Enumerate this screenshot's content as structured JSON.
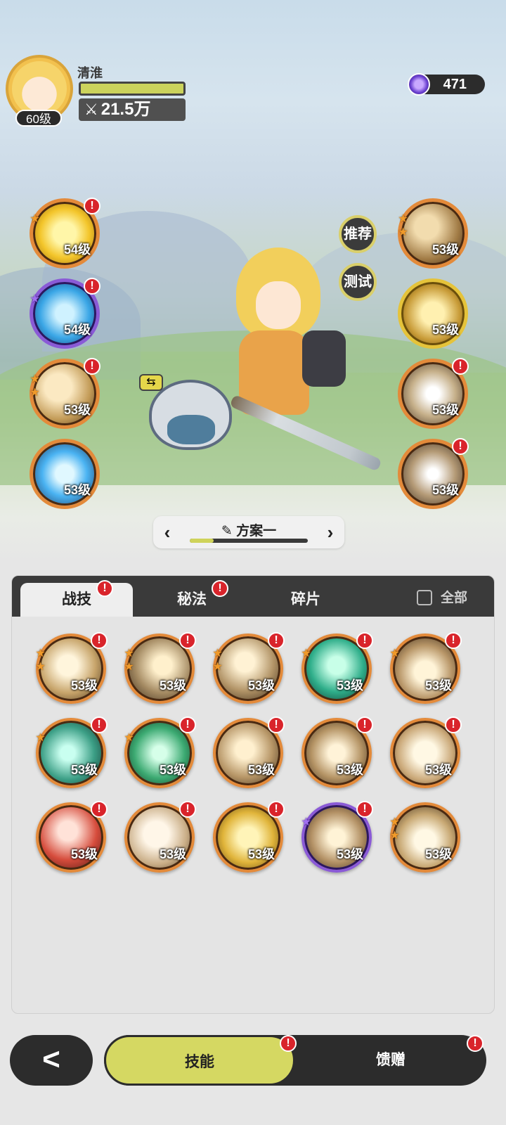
{
  "profile": {
    "name": "清淮",
    "level": "60级",
    "power": "21.5万",
    "currency": "471"
  },
  "side_buttons": {
    "recommend": "推荐",
    "test": "测试"
  },
  "left_slots": [
    {
      "level": "54级",
      "alert": "!",
      "tier": "orange",
      "stars": "★",
      "icon": "golden-crystal-icon"
    },
    {
      "level": "54级",
      "alert": "!",
      "tier": "purple",
      "stars": "★",
      "icon": "blue-vortex-icon"
    },
    {
      "level": "53级",
      "alert": "!",
      "tier": "orange",
      "stars": "★★",
      "icon": "horn-icon"
    },
    {
      "level": "53级",
      "alert": "",
      "tier": "orange",
      "stars": "",
      "icon": "ice-shard-icon"
    }
  ],
  "right_slots": [
    {
      "level": "53级",
      "alert": "",
      "tier": "orange",
      "stars": "★★",
      "icon": "fist-icon"
    },
    {
      "level": "53级",
      "alert": "",
      "tier": "gold",
      "stars": "",
      "icon": "golden-orb-icon"
    },
    {
      "level": "53级",
      "alert": "!",
      "tier": "orange",
      "stars": "",
      "icon": "wind-spiral-icon"
    },
    {
      "level": "53级",
      "alert": "!",
      "tier": "orange",
      "stars": "",
      "icon": "dagger-icon"
    }
  ],
  "plan": {
    "title": "方案一",
    "progress": 0.2
  },
  "tabs": [
    {
      "label": "战技",
      "alert": "!"
    },
    {
      "label": "秘法",
      "alert": "!"
    },
    {
      "label": "碎片",
      "alert": ""
    }
  ],
  "select_all_label": "全部",
  "skills": [
    {
      "level": "53级",
      "alert": "!",
      "tier": "orange",
      "stars": "★★",
      "icon": "slash-strike-icon"
    },
    {
      "level": "53级",
      "alert": "!",
      "tier": "orange",
      "stars": "★★",
      "icon": "wind-slash-icon"
    },
    {
      "level": "53级",
      "alert": "!",
      "tier": "orange",
      "stars": "★★",
      "icon": "leap-strike-icon"
    },
    {
      "level": "53级",
      "alert": "!",
      "tier": "orange",
      "stars": "★",
      "icon": "green-wave-icon"
    },
    {
      "level": "53级",
      "alert": "!",
      "tier": "orange",
      "stars": "★",
      "icon": "ground-burst-icon"
    },
    {
      "level": "53级",
      "alert": "!",
      "tier": "orange",
      "stars": "★",
      "icon": "web-icon"
    },
    {
      "level": "53级",
      "alert": "!",
      "tier": "orange",
      "stars": "★",
      "icon": "green-sword-icon"
    },
    {
      "level": "53级",
      "alert": "!",
      "tier": "orange",
      "stars": "",
      "icon": "crescent-icon"
    },
    {
      "level": "53级",
      "alert": "!",
      "tier": "orange",
      "stars": "",
      "icon": "whirlwind-icon"
    },
    {
      "level": "53级",
      "alert": "!",
      "tier": "orange",
      "stars": "",
      "icon": "triple-orb-icon"
    },
    {
      "level": "53级",
      "alert": "!",
      "tier": "orange",
      "stars": "",
      "icon": "red-blade-icon"
    },
    {
      "level": "53级",
      "alert": "!",
      "tier": "orange",
      "stars": "",
      "icon": "elephant-icon"
    },
    {
      "level": "53级",
      "alert": "!",
      "tier": "orange",
      "stars": "",
      "icon": "golden-rune-icon"
    },
    {
      "level": "53级",
      "alert": "!",
      "tier": "purple",
      "stars": "★",
      "icon": "star-burst-icon"
    },
    {
      "level": "53级",
      "alert": "",
      "tier": "orange",
      "stars": "★★",
      "icon": "explosion-icon"
    }
  ],
  "bottom_nav": {
    "back": "<",
    "tabs": [
      {
        "label": "技能",
        "alert": "!"
      },
      {
        "label": "馈赠",
        "alert": "!"
      }
    ]
  },
  "colors": {
    "accent": "#d5d862",
    "orange_tier": "#e38a3a",
    "purple_tier": "#8a5ad6",
    "gold_tier": "#e5c33a",
    "alert": "#d9242b"
  }
}
